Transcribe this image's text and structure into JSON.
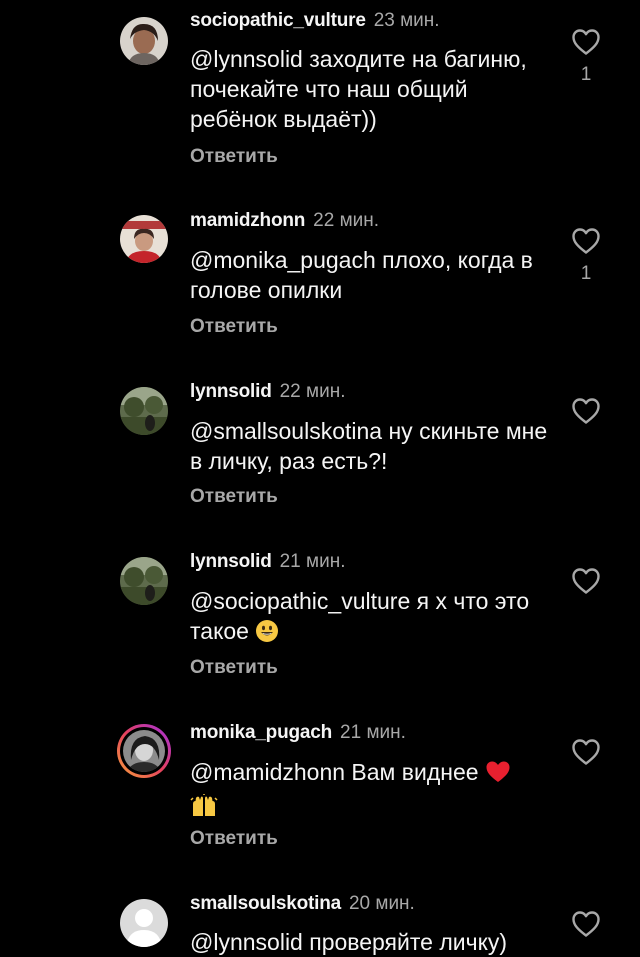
{
  "colors": {
    "background": "#000000",
    "text": "#f5f5f5",
    "secondary_text": "#a8a8a8",
    "heart_emoji": "#e8202f",
    "smile_emoji": "#f7c843",
    "story_ring_gradient": [
      "#f9a13a",
      "#e4405f",
      "#a02fe3"
    ]
  },
  "comments": [
    {
      "username": "sociopathic_vulture",
      "time": "23 мин.",
      "text": "@lynnsolid заходите на багиню, почекайте что наш общий ребёнок выдаёт))",
      "reply_label": "Ответить",
      "like_count": "1",
      "avatar_icon": "user-photo-avatar"
    },
    {
      "username": "mamidzhonn",
      "time": "22 мин.",
      "text": "@monika_pugach плохо, когда в голове опилки",
      "reply_label": "Ответить",
      "like_count": "1",
      "avatar_icon": "user-photo-avatar"
    },
    {
      "username": "lynnsolid",
      "time": "22 мин.",
      "text": "@smallsoulskotina ну скиньте мне в личку, раз есть?!",
      "reply_label": "Ответить",
      "like_count": "",
      "avatar_icon": "landscape-photo-avatar"
    },
    {
      "username": "lynnsolid",
      "time": "21 мин.",
      "text": "@sociopathic_vulture я х что это такое",
      "text_emoji": "grinning-face-emoji",
      "reply_label": "Ответить",
      "like_count": "",
      "avatar_icon": "landscape-photo-avatar"
    },
    {
      "username": "monika_pugach",
      "time": "21 мин.",
      "text": "@mamidzhonn Вам виднее",
      "text_emoji": [
        "red-heart-emoji",
        "raising-hands-emoji"
      ],
      "reply_label": "Ответить",
      "like_count": "",
      "avatar_icon": "story-ring-avatar"
    },
    {
      "username": "smallsoulskotina",
      "time": "20 мин.",
      "text": "@lynnsolid проверяйте личку)",
      "reply_label": "",
      "like_count": "",
      "avatar_icon": "default-user-avatar"
    }
  ]
}
